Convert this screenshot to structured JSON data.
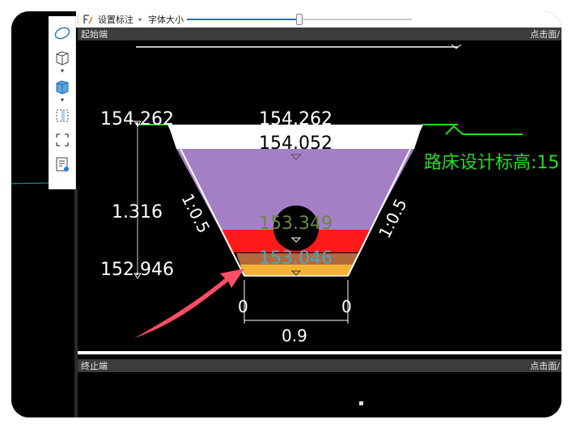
{
  "toolbar": {
    "annotation_label": "设置标注",
    "font_size_label": "字体大小",
    "font_slider_level": 0.5
  },
  "panels": {
    "start": {
      "title": "起始端",
      "right_label": "点击面/"
    },
    "end": {
      "title": "终止端",
      "right_label": "点击面/"
    }
  },
  "section": {
    "left_top_elev": "154.262",
    "center_top_elev": "154.262",
    "center_elev_2": "154.052",
    "center_elev_3": "153.349",
    "center_elev_4": "153.046",
    "left_bottom_elev": "152.946",
    "depth": "1.316",
    "left_slope": "1:0.5",
    "right_slope": "1:0.5",
    "bottom_left_offset": "0",
    "bottom_right_offset": "0",
    "bottom_width": "0.9",
    "design_label": "路床设计标高:15"
  },
  "colors": {
    "background": "#000000",
    "white_layer": "#ffffff",
    "purple_layer": "#a47fc6",
    "red_layer": "#ff1a1a",
    "brown_layer": "#b26a3c",
    "orange_layer": "#f5b335",
    "green": "#20e020",
    "elev_3_text": "#6b8a3a",
    "elev_4_text": "#4aa8c8",
    "arrow": "#ff4d63"
  },
  "icons": [
    "ellipse-icon",
    "cube-outline-icon",
    "cube-filled-icon",
    "box-select-icon",
    "corners-select-icon",
    "properties-icon",
    "annotation-icon"
  ]
}
